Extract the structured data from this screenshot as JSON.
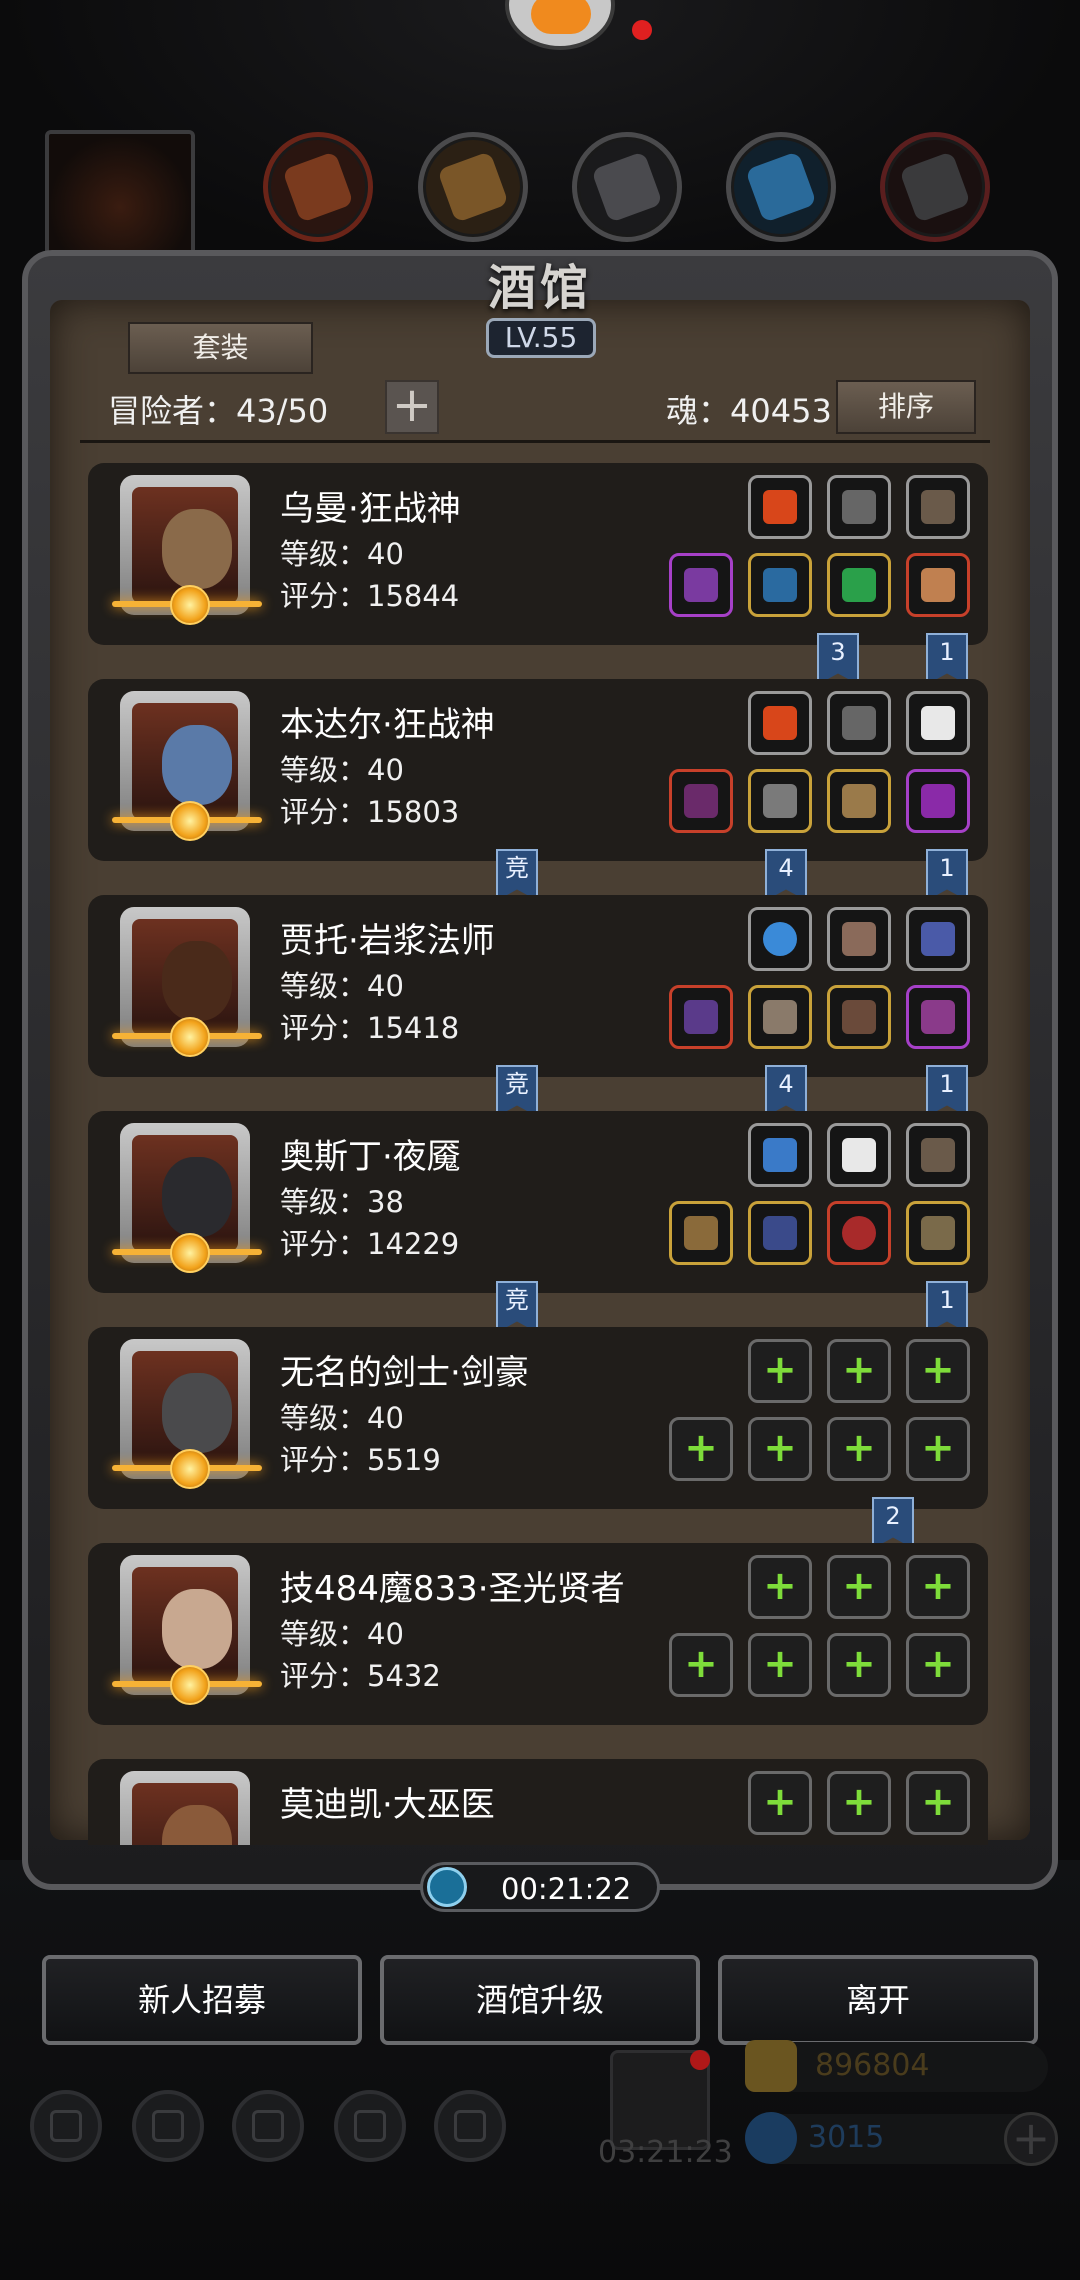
{
  "header": {
    "title": "酒馆",
    "level_badge": "LV.55",
    "suit_button": "套装",
    "adventurer_text": "冒险者：43/50",
    "soul_text": "魂：40453",
    "sort_button": "排序"
  },
  "heroes": [
    {
      "name": "乌曼·狂战神",
      "level": "等级：40",
      "score": "评分：15844"
    },
    {
      "name": "本达尔·狂战神",
      "level": "等级：40",
      "score": "评分：15803"
    },
    {
      "name": "贾托·岩浆法师",
      "level": "等级：40",
      "score": "评分：15418"
    },
    {
      "name": "奥斯丁·夜魇",
      "level": "等级：38",
      "score": "评分：14229"
    },
    {
      "name": "无名的剑士·剑豪",
      "level": "等级：40",
      "score": "评分：5519"
    },
    {
      "name": "技484魔833·圣光贤者",
      "level": "等级：40",
      "score": "评分：5432"
    },
    {
      "name": "莫迪凯·大巫医",
      "level": "",
      "score": ""
    }
  ],
  "ribbons": {
    "r1a": "3",
    "r1b": "1",
    "r2a": "竞",
    "r2b": "4",
    "r2c": "1",
    "r3a": "竞",
    "r3b": "4",
    "r3c": "1",
    "r4a": "竞",
    "r4b": "1",
    "r5a": "2"
  },
  "empty_slot_symbol": "+",
  "timer": "00:21:22",
  "bottom_buttons": {
    "recruit": "新人招募",
    "upgrade": "酒馆升级",
    "leave": "离开"
  },
  "bottom_bar": {
    "gift_timer": "03:21:23",
    "gold": "896804",
    "diamonds": "3015",
    "add_symbol": "+"
  },
  "colors": {
    "accent_gold": "#f6b236",
    "empty_slot_plus": "#7edc3a",
    "ribbon_blue": "#2a4c7a"
  }
}
